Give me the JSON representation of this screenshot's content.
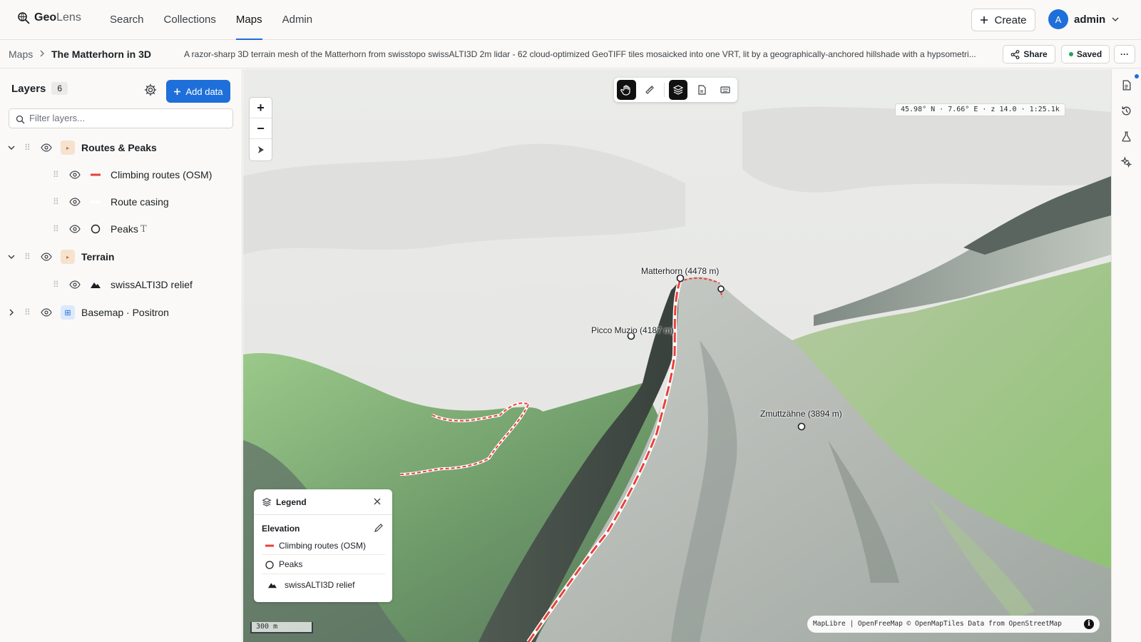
{
  "app": {
    "name_strong": "Geo",
    "name_light": "Lens"
  },
  "nav": {
    "tabs": [
      "Search",
      "Collections",
      "Maps",
      "Admin"
    ],
    "active": "Maps"
  },
  "header": {
    "create_label": "Create",
    "user_initial": "A",
    "user_name": "admin"
  },
  "breadcrumb": {
    "root": "Maps",
    "title": "The Matterhorn in 3D",
    "description": "A razor-sharp 3D terrain mesh of the Matterhorn from swisstopo swissALTI3D 2m lidar - 62 cloud-optimized GeoTIFF tiles mosaicked into one VRT, lit by a geographically-anchored hillshade with a hypsometri...",
    "share_label": "Share",
    "saved_label": "Saved",
    "more_label": "···"
  },
  "layers_panel": {
    "title": "Layers",
    "count": "6",
    "add_label": "Add data",
    "filter_placeholder": "Filter layers...",
    "items": [
      {
        "name": "Routes & Peaks",
        "kind": "group",
        "expanded": true
      },
      {
        "name": "Climbing routes (OSM)",
        "kind": "line",
        "color": "#e8403a"
      },
      {
        "name": "Route casing",
        "kind": "line",
        "color": "#ffffff"
      },
      {
        "name": "Peaks",
        "kind": "point",
        "label_icon": "T"
      },
      {
        "name": "Terrain",
        "kind": "group",
        "expanded": true
      },
      {
        "name": "swissALTI3D relief",
        "kind": "raster"
      },
      {
        "name": "Basemap · Positron",
        "kind": "basemap",
        "expanded": false
      }
    ]
  },
  "map": {
    "coord_readout": "45.98° N · 7.66° E · z 14.0 · 1:25.1k",
    "peaks": [
      {
        "label": "Matterhorn (4478 m)"
      },
      {
        "label": "Picco Muzio (4187 m)"
      },
      {
        "label": "Zmuttzähne (3894 m)"
      }
    ],
    "scale_label": "300 m",
    "attribution": "MapLibre | OpenFreeMap © OpenMapTiles Data from OpenStreetMap",
    "route_color": "#e8403a"
  },
  "legend": {
    "title": "Legend",
    "section": "Elevation",
    "items": [
      {
        "label": "Climbing routes (OSM)"
      },
      {
        "label": "Peaks"
      },
      {
        "label": "swissALTI3D relief"
      }
    ]
  },
  "colors": {
    "accent": "#1e6fd9",
    "saved": "#21a35a"
  }
}
